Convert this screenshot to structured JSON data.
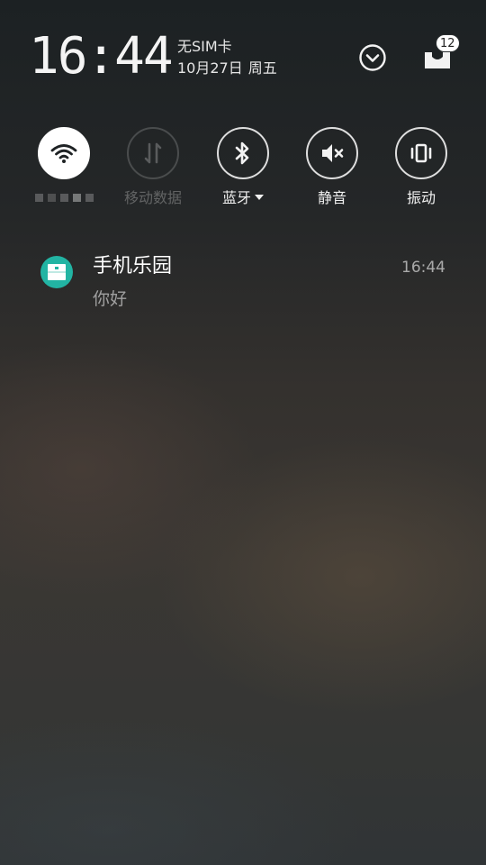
{
  "status": {
    "time": "16:44",
    "carrier": "无SIM卡",
    "date": "10月27日",
    "weekday": "周五",
    "inbox_count": "12"
  },
  "header": {
    "expand_icon": "chevron-down-circle-icon",
    "inbox_icon": "notification-inbox-icon"
  },
  "quick_toggles": [
    {
      "id": "wifi",
      "icon": "wifi-icon",
      "label": "",
      "state": "on",
      "label_obscured": true
    },
    {
      "id": "mobile-data",
      "icon": "mobile-data-arrows-icon",
      "label": "移动数据",
      "state": "disabled"
    },
    {
      "id": "bluetooth",
      "icon": "bluetooth-icon",
      "label": "蓝牙",
      "state": "off",
      "has_dropdown": true
    },
    {
      "id": "mute",
      "icon": "speaker-mute-icon",
      "label": "静音",
      "state": "off"
    },
    {
      "id": "vibrate",
      "icon": "vibrate-icon",
      "label": "振动",
      "state": "off"
    }
  ],
  "notifications": [
    {
      "app_name": "手机乐园",
      "message": "你好",
      "time": "16:44",
      "icon": "app-store-icon",
      "icon_color": "#22b4a3"
    }
  ],
  "colors": {
    "badge_bg": "#ffffff",
    "toggle_active_bg": "#ffffff",
    "text_primary": "#ffffff"
  }
}
